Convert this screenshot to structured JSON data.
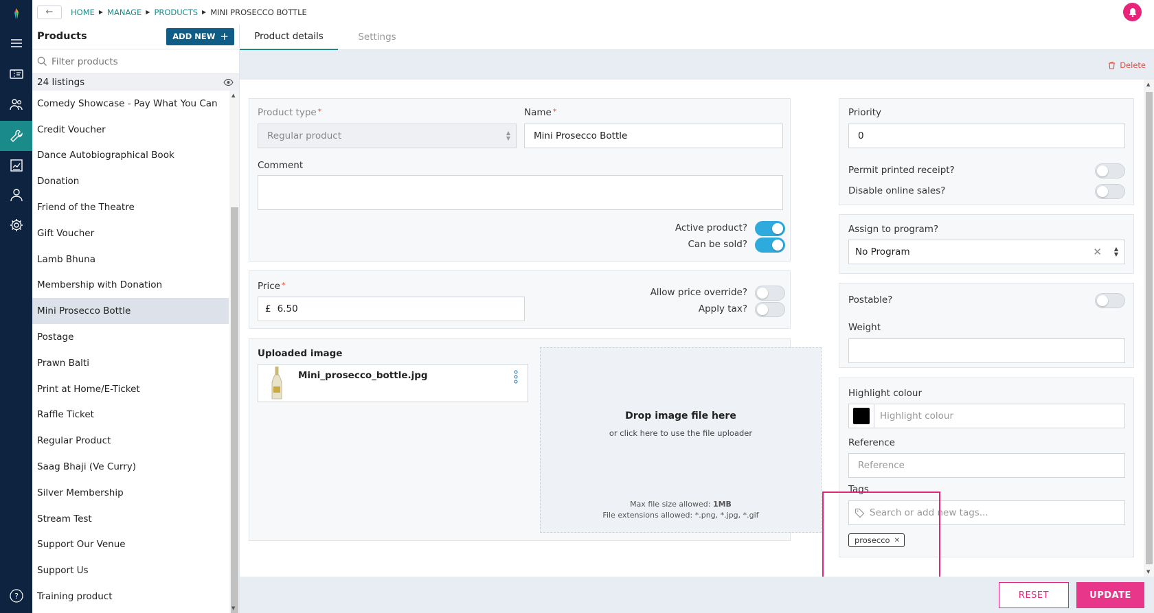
{
  "breadcrumb": [
    "HOME",
    "MANAGE",
    "PRODUCTS",
    "MINI PROSECCO BOTTLE"
  ],
  "sidebar": {
    "title": "Products",
    "add_new_label": "ADD NEW",
    "filter_placeholder": "Filter products",
    "count_label": "24 listings",
    "items": [
      "Comedy Showcase - Pay What You Can",
      "Credit Voucher",
      "Dance Autobiographical Book",
      "Donation",
      "Friend of the Theatre",
      "Gift Voucher",
      "Lamb Bhuna",
      "Membership with Donation",
      "Mini Prosecco Bottle",
      "Postage",
      "Prawn Balti",
      "Print at Home/E-Ticket",
      "Raffle Ticket",
      "Regular Product",
      "Saag Bhaji (Ve Curry)",
      "Silver Membership",
      "Stream Test",
      "Support Our Venue",
      "Support Us",
      "Training product"
    ],
    "selected_item": "Mini Prosecco Bottle"
  },
  "tabs": [
    "Product details",
    "Settings"
  ],
  "delete_label": "Delete",
  "form": {
    "product_type_label": "Product type",
    "product_type_value": "Regular product",
    "name_label": "Name",
    "name_value": "Mini Prosecco Bottle",
    "comment_label": "Comment",
    "comment_value": "",
    "active_label": "Active product?",
    "active_on": true,
    "can_sold_label": "Can be sold?",
    "can_sold_on": true,
    "price_label": "Price",
    "price_currency": "£",
    "price_value": "6.50",
    "allow_override_label": "Allow price override?",
    "allow_override_on": false,
    "apply_tax_label": "Apply tax?",
    "apply_tax_on": false,
    "uploaded_image_label": "Uploaded image",
    "image_filename": "Mini_prosecco_bottle.jpg",
    "drop_title": "Drop image file here",
    "drop_sub": "or click here to use the file uploader",
    "max_size_prefix": "Max file size allowed: ",
    "max_size_value": "1MB",
    "extensions_text": "File extensions allowed: *.png, *.jpg, *.gif"
  },
  "right": {
    "priority_label": "Priority",
    "priority_value": "0",
    "permit_receipt_label": "Permit printed receipt?",
    "permit_receipt_on": false,
    "disable_online_label": "Disable online sales?",
    "disable_online_on": false,
    "assign_program_label": "Assign to program?",
    "assign_program_value": "No Program",
    "postable_label": "Postable?",
    "postable_on": false,
    "weight_label": "Weight",
    "weight_value": "",
    "highlight_label": "Highlight colour",
    "highlight_placeholder": "Highlight colour",
    "highlight_swatch": "#000000",
    "reference_label": "Reference",
    "reference_placeholder": "Reference",
    "tags_label": "Tags",
    "tags_placeholder": "Search or add new tags...",
    "tags": [
      "prosecco"
    ]
  },
  "footer": {
    "reset_label": "RESET",
    "update_label": "UPDATE"
  },
  "colors": {
    "rail": "#0d2340",
    "accent_teal": "#1a8a8a",
    "brand_pink": "#e8378a",
    "toggle_on": "#2eaadc",
    "primary_blue": "#0f5c86"
  }
}
